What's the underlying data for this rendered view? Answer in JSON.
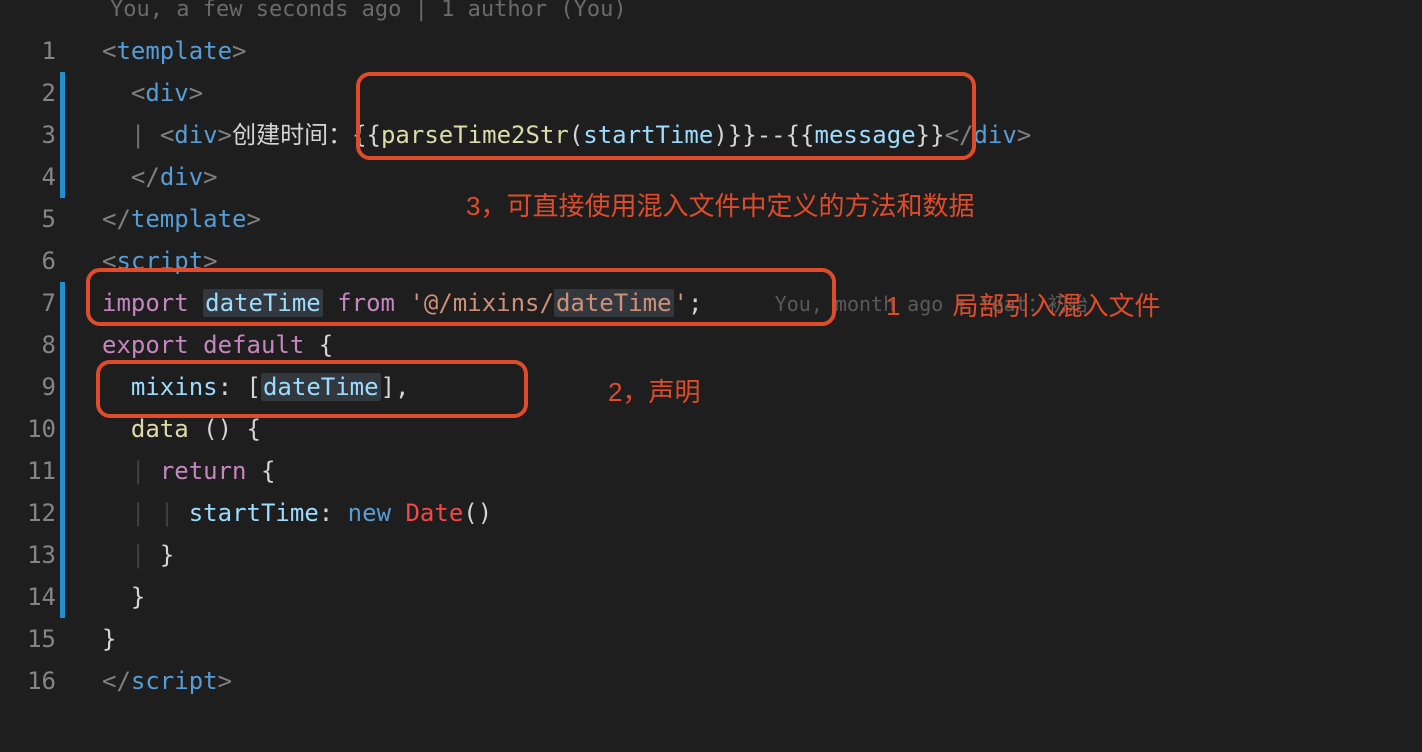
{
  "blame_header": "You, a few seconds ago | 1 author (You)",
  "line_numbers": [
    "1",
    "2",
    "3",
    "4",
    "5",
    "6",
    "7",
    "8",
    "9",
    "10",
    "11",
    "12",
    "13",
    "14",
    "15",
    "16"
  ],
  "code": {
    "l1": {
      "open": "<",
      "tag": "template",
      "close": ">"
    },
    "l2": {
      "open": "<",
      "tag": "div",
      "close": ">"
    },
    "l3": {
      "open": "<",
      "tag": "div",
      "close": ">",
      "text": "创建时间：",
      "expr_open": "{{",
      "func": "parseTime2Str",
      "paren_open": "(",
      "arg": "startTime",
      "paren_close": ")",
      "expr_close": "}}",
      "sep": "--",
      "expr2_open": "{{",
      "var": "message",
      "expr2_close": "}}",
      "close_open": "</",
      "close_tag": "div",
      "close_close": ">"
    },
    "l4": {
      "open": "</",
      "tag": "div",
      "close": ">"
    },
    "l5": {
      "open": "</",
      "tag": "template",
      "close": ">"
    },
    "l6": {
      "open": "<",
      "tag": "script",
      "close": ">"
    },
    "l7": {
      "import": "import",
      "var": "dateTime",
      "from": "from",
      "str": "'@/mixins/dateTime'",
      "semi": ";"
    },
    "l8": {
      "export": "export",
      "default": "default",
      "brace": "{"
    },
    "l9": {
      "prop": "mixins",
      "colon": ":",
      "bracket_open": "[",
      "var": "dateTime",
      "bracket_close": "]",
      "comma": ","
    },
    "l10": {
      "method": "data",
      "parens": "()",
      "brace": "{"
    },
    "l11": {
      "return": "return",
      "brace": "{"
    },
    "l12": {
      "prop": "startTime",
      "colon": ":",
      "new": "new",
      "class": "Date",
      "parens": "()"
    },
    "l13": {
      "brace": "}"
    },
    "l14": {
      "brace": "}"
    },
    "l15": {
      "brace": "}"
    },
    "l16": {
      "open": "</",
      "tag": "script",
      "close": ">"
    }
  },
  "git_blame_l7": {
    "prefix": "You,",
    "text1": " month ago",
    "dot": "•",
    "text2": "feat：初始"
  },
  "annotations": {
    "box1_label": "1，局部引入混入文件",
    "box2_label": "2，声明",
    "box3_label": "3，可直接使用混入文件中定义的方法和数据"
  }
}
